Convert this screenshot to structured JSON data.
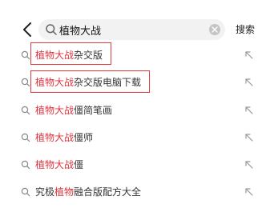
{
  "search": {
    "query": "植物大战",
    "submit_label": "搜索"
  },
  "colors": {
    "highlight": "#e0343f",
    "annotation": "#e43a3a",
    "search_bg": "#f2f2f2"
  },
  "icons": {
    "back": "chevron-left-icon",
    "search": "search-icon",
    "clear": "clear-icon",
    "fill_arrow": "arrow-up-left-icon"
  },
  "suggestions": [
    {
      "pre": "",
      "hl": "植物大战",
      "post": "杂交版",
      "boxed": true
    },
    {
      "pre": "",
      "hl": "植物大战",
      "post": "杂交版电脑下载",
      "boxed": true
    },
    {
      "pre": "",
      "hl": "植物大战",
      "post": "僵简笔画",
      "boxed": false
    },
    {
      "pre": "",
      "hl": "植物大战",
      "post": "僵师",
      "boxed": false
    },
    {
      "pre": "",
      "hl": "植物大战",
      "post": "僵",
      "boxed": false
    },
    {
      "pre": "究极",
      "hl": "植物",
      "post": "融合版配方大全",
      "boxed": false
    }
  ]
}
